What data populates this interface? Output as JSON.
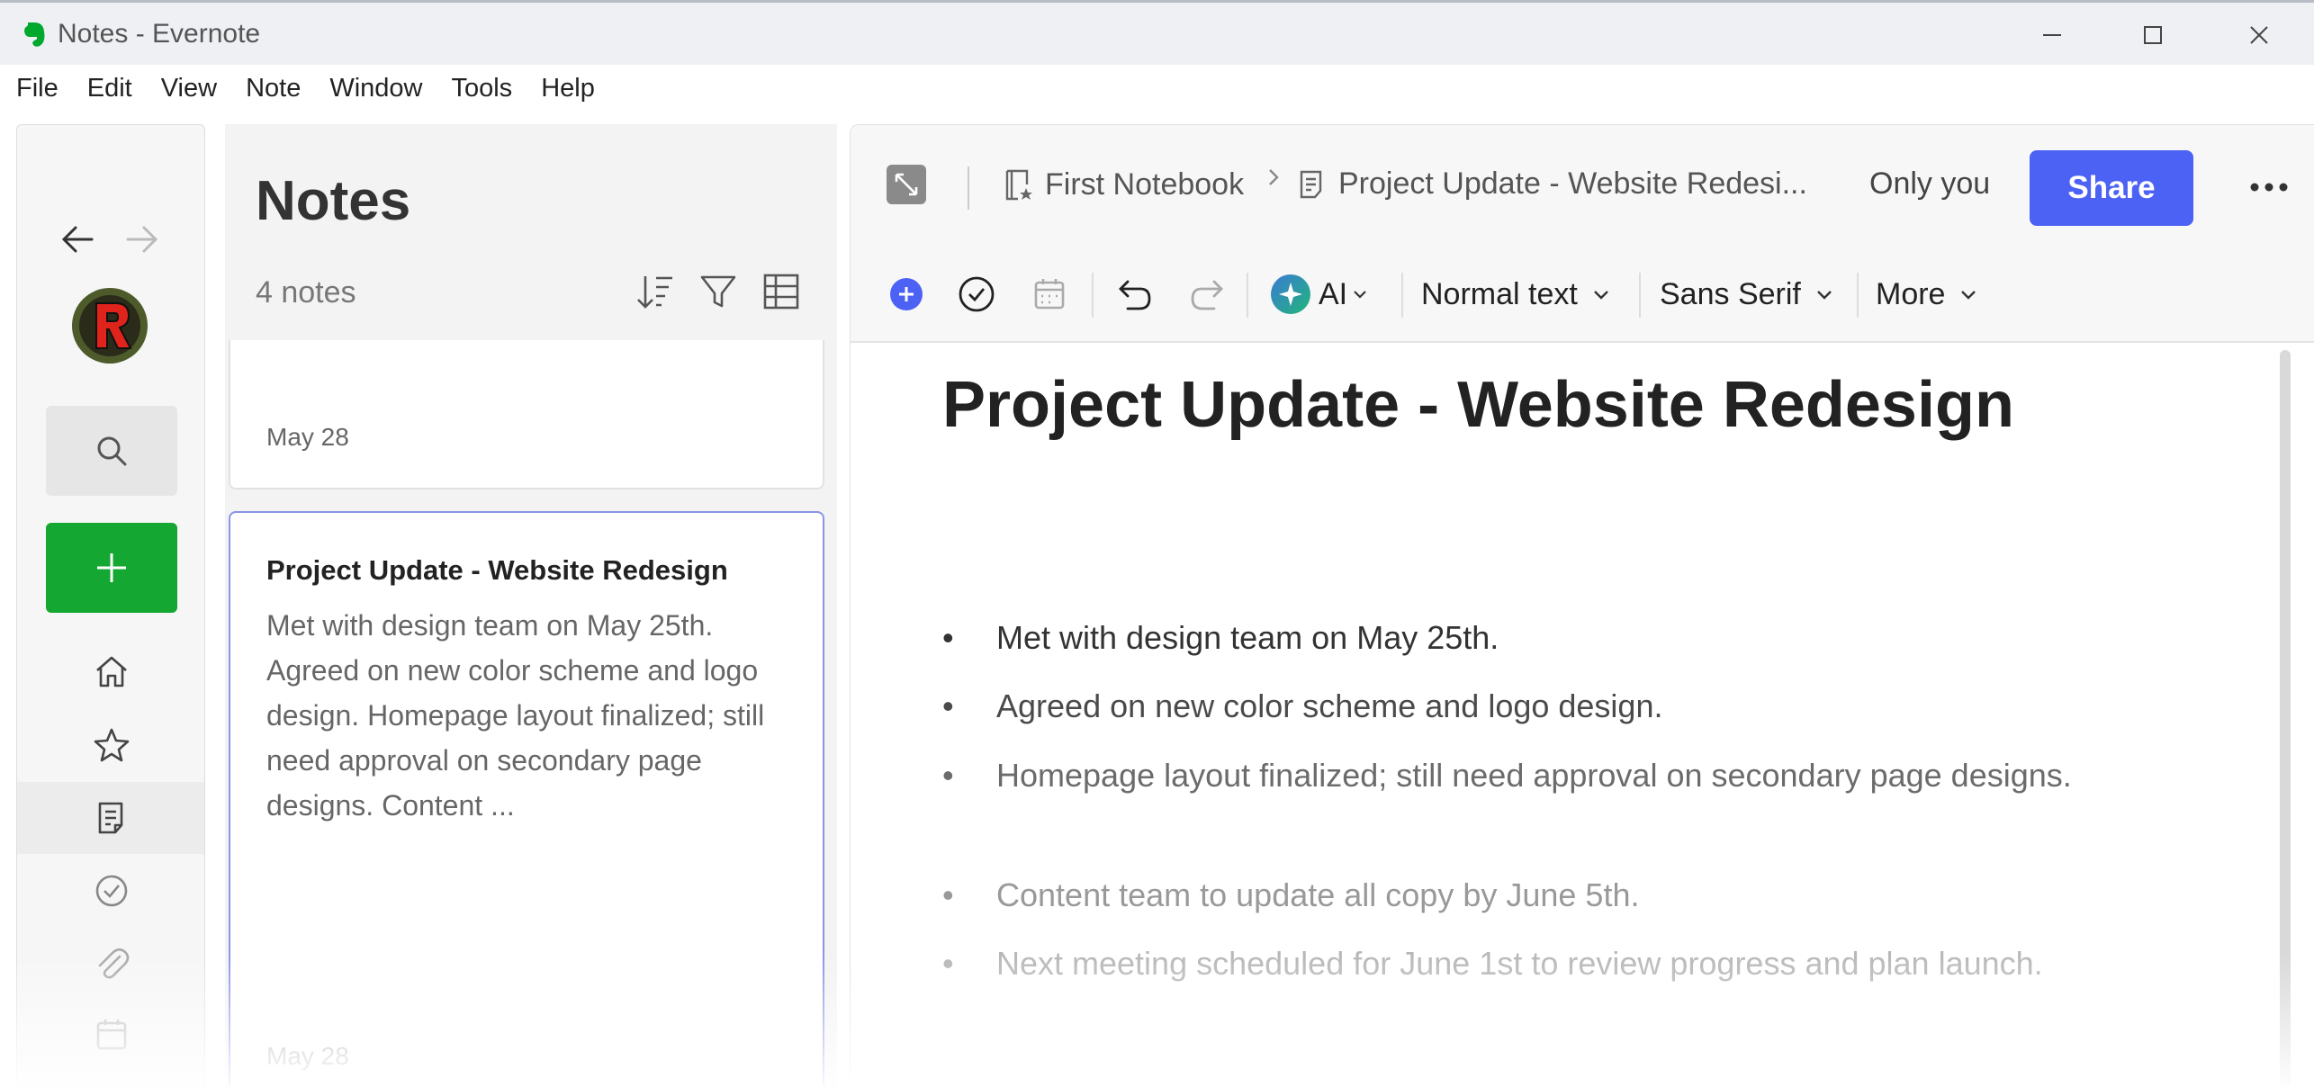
{
  "window": {
    "title": "Notes - Evernote"
  },
  "menu": [
    "File",
    "Edit",
    "View",
    "Note",
    "Window",
    "Tools",
    "Help"
  ],
  "notes_list": {
    "heading": "Notes",
    "count": "4 notes",
    "cards": [
      {
        "date": "May 28"
      },
      {
        "title": "Project Update - Website Redesign",
        "snippet": "Met with design team on May 25th. Agreed on new color scheme and logo design. Homepage layout finalized; still need approval on secondary page designs. Content ...",
        "date": "May 28"
      }
    ]
  },
  "editor": {
    "breadcrumb": {
      "notebook": "First Notebook",
      "note": "Project Update - Website Redesi..."
    },
    "visibility": "Only you",
    "share_label": "Share",
    "toolbar": {
      "ai": "AI",
      "style": "Normal text",
      "font": "Sans Serif",
      "more": "More"
    },
    "title": "Project Update - Website Redesign",
    "bullets": [
      {
        "text": "Met with design team on May 25th.",
        "color": "#333333"
      },
      {
        "text": "Agreed on new color scheme and logo design.",
        "color": "#4a4a4a"
      },
      {
        "text": "Homepage layout finalized; still need approval on secondary page designs.",
        "color": "#6b6b6b"
      },
      {
        "text": "Content team to update all copy by June 5th.",
        "color": "#999999"
      },
      {
        "text": "Next meeting scheduled for June 1st to review progress and plan launch.",
        "color": "#b8b8b8"
      }
    ]
  },
  "colors": {
    "accent": "#4c62f5",
    "new_note": "#14a732",
    "brand": "#00a82d"
  }
}
